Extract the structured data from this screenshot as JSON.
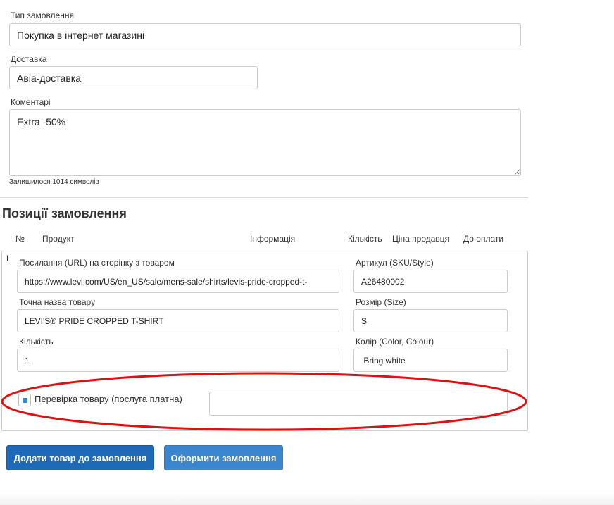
{
  "order": {
    "type_label": "Тип замовлення",
    "type_value": "Покупка в інтернет магазині",
    "delivery_label": "Доставка",
    "delivery_value": "Авіа-доставка",
    "comments_label": "Коментарі",
    "comments_value": "Extra -50%",
    "remaining": "Залишилося 1014 символів"
  },
  "positions": {
    "title": "Позиції замовлення",
    "headers": [
      "№",
      "Продукт",
      "Інформація",
      "Кількість",
      "Ціна продавця",
      "До оплати"
    ],
    "item": {
      "number": "1",
      "url_label": "Посилання (URL) на сторінку з товаром",
      "url_value": "https://www.levi.com/US/en_US/sale/mens-sale/shirts/levis-pride-cropped-t-",
      "sku_label": "Артикул (SKU/Style)",
      "sku_value": "A26480002",
      "name_label": "Точна назва товару",
      "name_value": "LEVI'S® PRIDE CROPPED T-SHIRT",
      "size_label": "Розмір (Size)",
      "size_value": "S",
      "qty_label": "Кількість",
      "qty_value": "1",
      "color_label": "Колір (Color, Colour)",
      "color_value": " Bring white",
      "check_label": "Перевірка товару (послуга платна)",
      "check_note_value": ""
    }
  },
  "buttons": {
    "add_item": "Додати товар до замовлення",
    "checkout": "Оформити замовлення"
  },
  "annotation": {
    "color": "#e01010"
  }
}
